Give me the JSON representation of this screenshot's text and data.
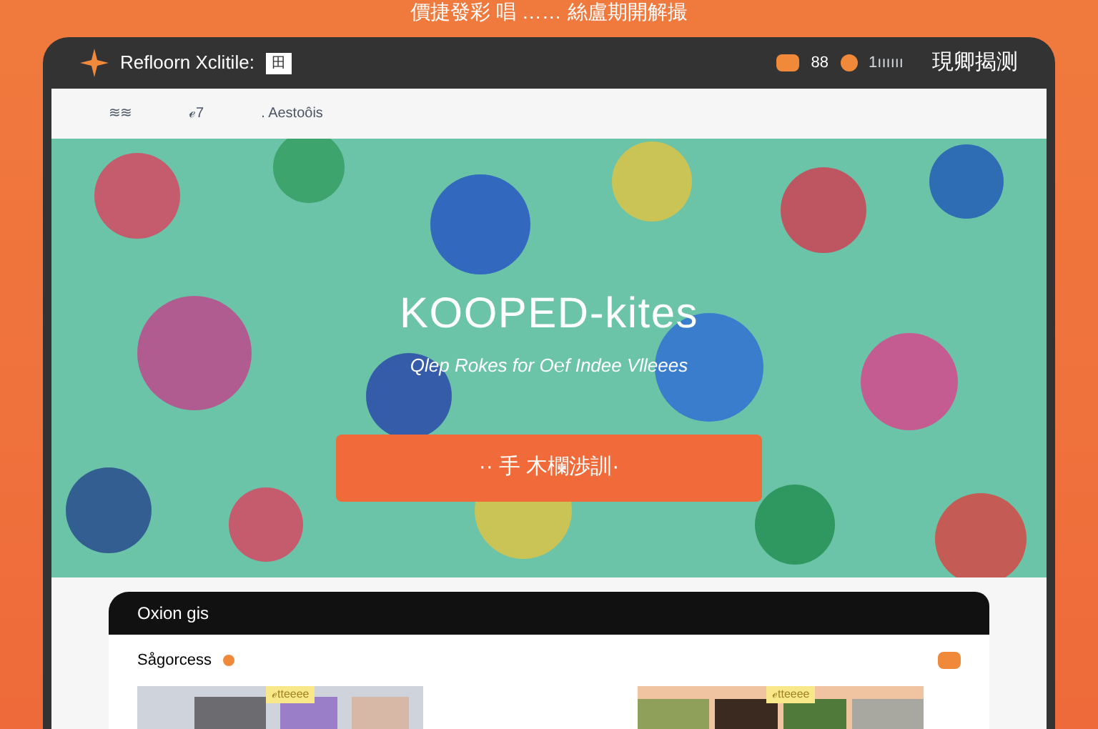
{
  "caption": "價捷發彩 唱 …… 絲盧期開解撮",
  "window": {
    "brand": "Refloorn Xclitile:",
    "badge": "田",
    "right_items": [
      "88",
      "1ıııııı"
    ],
    "right_title": "現卿揭测"
  },
  "nav": {
    "items": [
      "≋≋",
      "ℯ7",
      ". Aestoôis"
    ]
  },
  "hero": {
    "title": "KOOPED-kites",
    "subtitle": "Qlep Rokes for O℮f Indee Vlleees",
    "button": "·· 手 木欄渉訓·"
  },
  "section": {
    "title": "Oxion gis",
    "subtitle": "Sågorcess",
    "tags": [
      "ℯtteeee",
      "ℯtteeee"
    ]
  }
}
